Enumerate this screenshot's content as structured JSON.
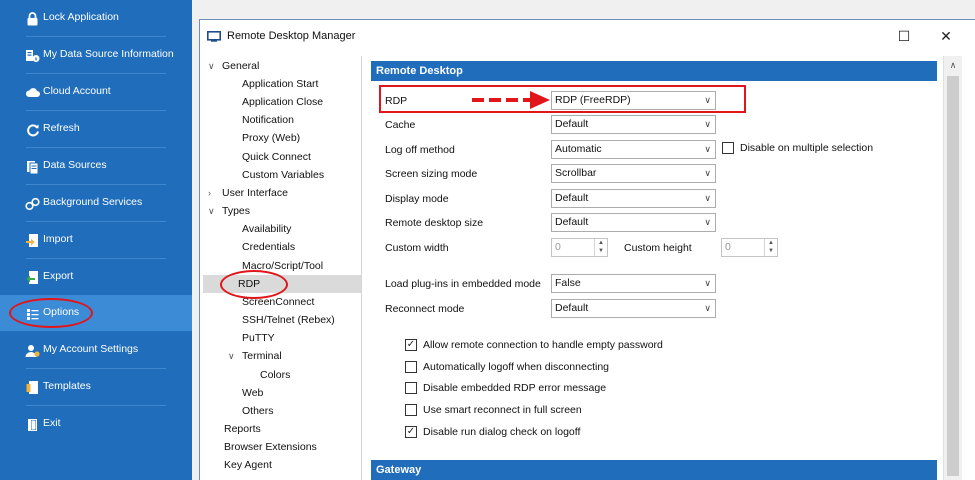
{
  "sidebar": {
    "items": [
      {
        "label": "Lock Application",
        "icon": "lock-icon"
      },
      {
        "label": "My Data Source Information",
        "icon": "data-source-info-icon"
      },
      {
        "label": "Cloud Account",
        "icon": "cloud-icon"
      },
      {
        "label": "Refresh",
        "icon": "refresh-icon"
      },
      {
        "label": "Data Sources",
        "icon": "database-icon"
      },
      {
        "label": "Background Services",
        "icon": "services-icon"
      },
      {
        "label": "Import",
        "icon": "import-icon"
      },
      {
        "label": "Export",
        "icon": "export-icon"
      },
      {
        "label": "Options",
        "icon": "options-icon"
      },
      {
        "label": "My Account Settings",
        "icon": "account-icon"
      },
      {
        "label": "Templates",
        "icon": "templates-icon"
      },
      {
        "label": "Exit",
        "icon": "exit-icon"
      }
    ],
    "selected": "Options"
  },
  "dialog": {
    "title": "Remote Desktop Manager",
    "maximize_glyph": "☐",
    "close_glyph": "✕"
  },
  "tree": {
    "general": "General",
    "application_start": "Application Start",
    "application_close": "Application Close",
    "notification": "Notification",
    "proxy_web": "Proxy (Web)",
    "quick_connect": "Quick Connect",
    "custom_variables": "Custom Variables",
    "user_interface": "User Interface",
    "types": "Types",
    "availability": "Availability",
    "credentials": "Credentials",
    "macro_script_tool": "Macro/Script/Tool",
    "rdp": "RDP",
    "screenconnect": "ScreenConnect",
    "ssh_telnet": "SSH/Telnet (Rebex)",
    "putty": "PuTTY",
    "terminal": "Terminal",
    "colors": "Colors",
    "web": "Web",
    "others": "Others",
    "reports": "Reports",
    "browser_extensions": "Browser Extensions",
    "key_agent": "Key Agent",
    "selected": "RDP"
  },
  "panel": {
    "section_remote_desktop": "Remote Desktop",
    "section_gateway": "Gateway",
    "rdp": {
      "label": "RDP",
      "value": "RDP (FreeRDP)"
    },
    "cache": {
      "label": "Cache",
      "value": "Default"
    },
    "log_off_method": {
      "label": "Log off method",
      "value": "Automatic"
    },
    "disable_multiple_selection": {
      "label": "Disable on multiple selection",
      "checked": false
    },
    "screen_sizing_mode": {
      "label": "Screen sizing mode",
      "value": "Scrollbar"
    },
    "display_mode": {
      "label": "Display mode",
      "value": "Default"
    },
    "remote_desktop_size": {
      "label": "Remote desktop size",
      "value": "Default"
    },
    "custom_width": {
      "label": "Custom width",
      "value": "0"
    },
    "custom_height": {
      "label": "Custom height",
      "value": "0"
    },
    "load_plugins": {
      "label": "Load plug-ins in embedded mode",
      "value": "False"
    },
    "reconnect_mode": {
      "label": "Reconnect mode",
      "value": "Default"
    },
    "checks": [
      {
        "label": "Allow remote connection to handle empty password",
        "checked": true
      },
      {
        "label": "Automatically logoff when disconnecting",
        "checked": false
      },
      {
        "label": "Disable embedded RDP error message",
        "checked": false
      },
      {
        "label": "Use smart reconnect in full screen",
        "checked": false
      },
      {
        "label": "Disable run dialog check on logoff",
        "checked": true
      }
    ]
  },
  "colors": {
    "sidebar_bg": "#1f6dbb",
    "sidebar_selected": "#3c8bd6",
    "section_header": "#1f6dbb",
    "annotation": "#e0161a"
  }
}
